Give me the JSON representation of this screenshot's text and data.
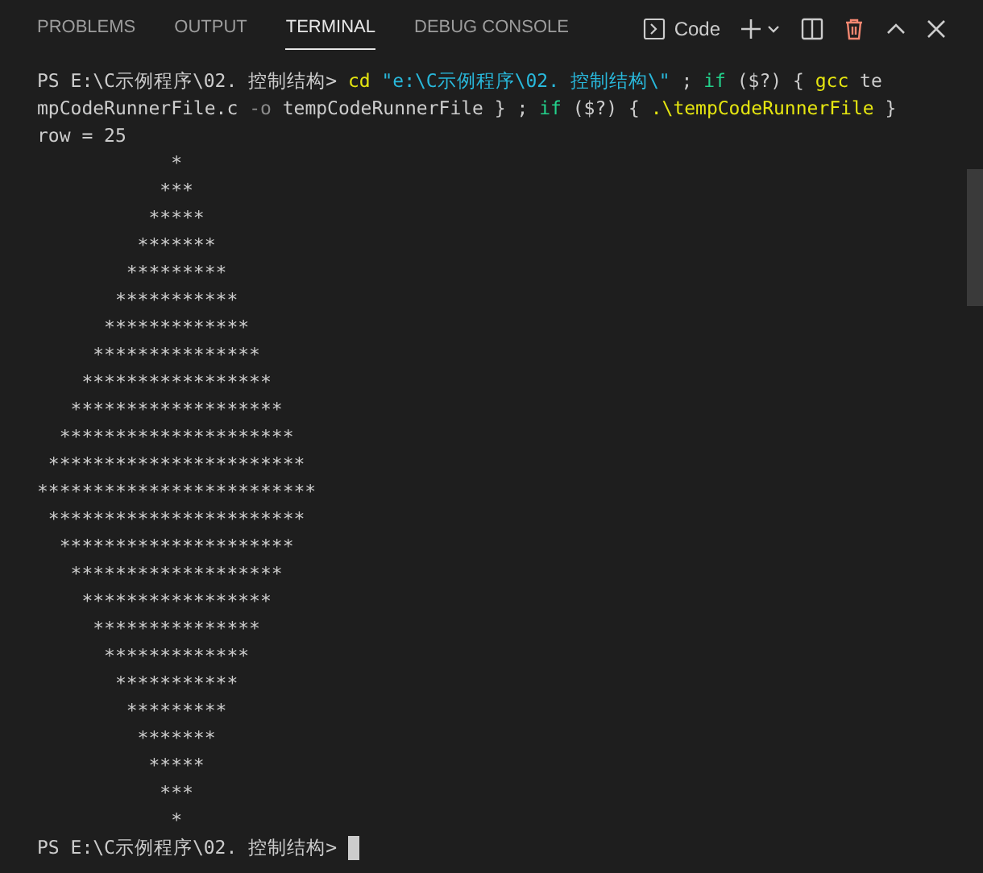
{
  "tabs": [
    {
      "label": "PROBLEMS",
      "selected": false
    },
    {
      "label": "OUTPUT",
      "selected": false
    },
    {
      "label": "TERMINAL",
      "selected": true
    },
    {
      "label": "DEBUG CONSOLE",
      "selected": false
    }
  ],
  "terminal_picker": {
    "label": "Code"
  },
  "lines": [
    {
      "segments": [
        {
          "kind": "prompt",
          "text": "PS E:\\C示例程序\\02. 控制结构> "
        },
        {
          "kind": "command",
          "text": "cd"
        },
        {
          "kind": "string",
          "text": " \"e:\\C示例程序\\02. 控制结构\\\""
        },
        {
          "kind": "plain",
          "text": " ; "
        },
        {
          "kind": "keyword",
          "text": "if"
        },
        {
          "kind": "plain",
          "text": " ($?) { "
        },
        {
          "kind": "command",
          "text": "gcc"
        },
        {
          "kind": "plain",
          "text": " te"
        }
      ]
    },
    {
      "segments": [
        {
          "kind": "plain",
          "text": "mpCodeRunnerFile.c "
        },
        {
          "kind": "param",
          "text": "-o"
        },
        {
          "kind": "plain",
          "text": " tempCodeRunnerFile } ; "
        },
        {
          "kind": "keyword",
          "text": "if"
        },
        {
          "kind": "plain",
          "text": " ($?) { "
        },
        {
          "kind": "command",
          "text": ".\\tempCodeRunnerFile"
        },
        {
          "kind": "plain",
          "text": " }"
        }
      ]
    },
    {
      "segments": [
        {
          "kind": "plain",
          "text": "row = 25"
        }
      ]
    },
    {
      "segments": [
        {
          "kind": "plain",
          "text": "            *\n           ***\n          *****\n         *******\n        *********\n       ***********\n      *************\n     ***************\n    *****************\n   *******************\n  *********************\n ***********************\n*************************\n ***********************\n  *********************\n   *******************\n    *****************\n     ***************\n      *************\n       ***********\n        *********\n         *******\n          *****\n           ***\n            *"
        }
      ]
    },
    {
      "segments": [
        {
          "kind": "prompt",
          "text": "PS E:\\C示例程序\\02. 控制结构> "
        }
      ],
      "cursor": true
    }
  ]
}
